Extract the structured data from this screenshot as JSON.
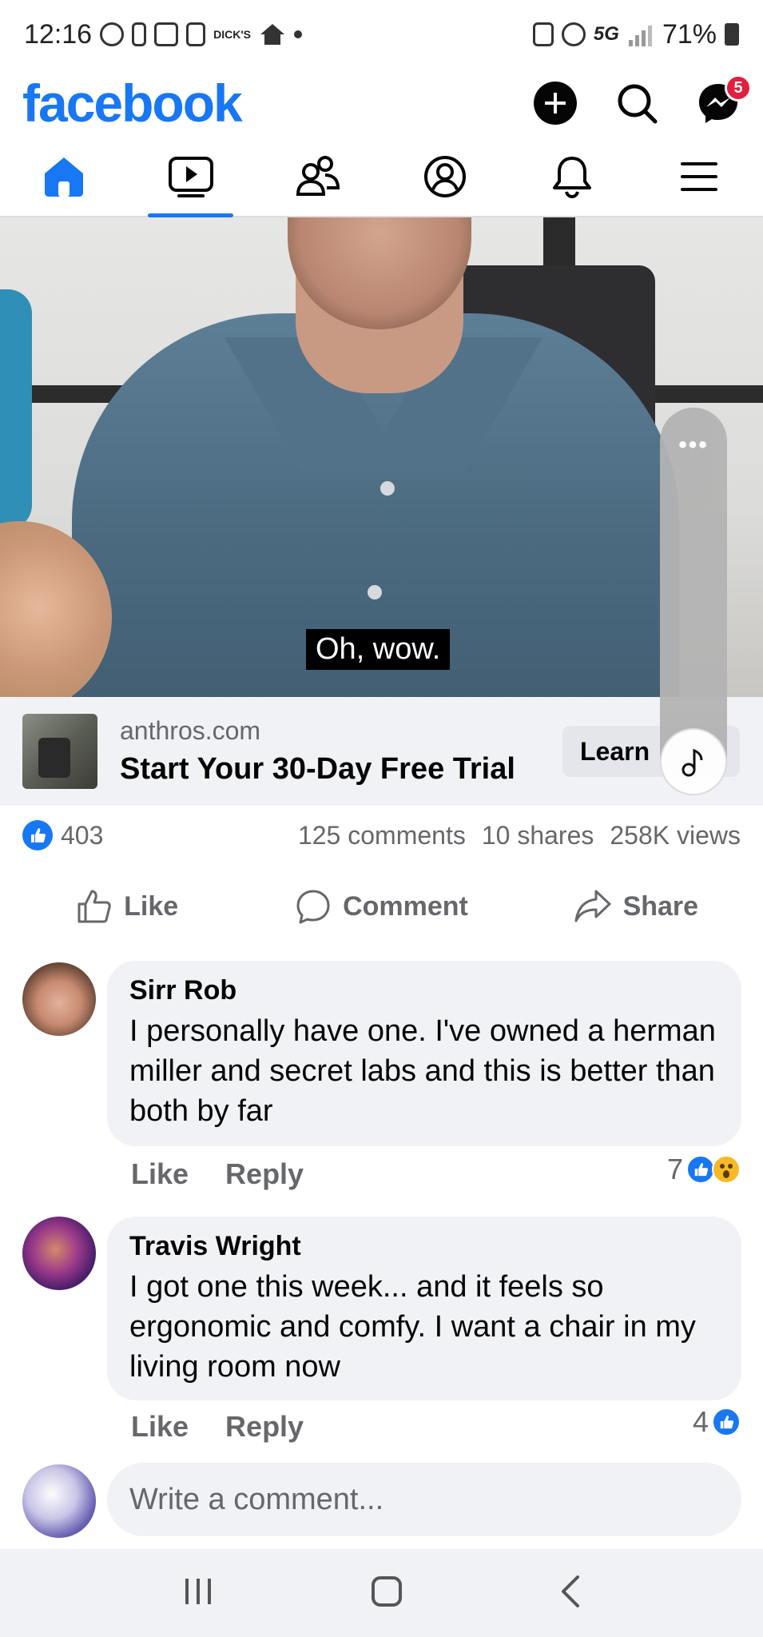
{
  "status_bar": {
    "time": "12:16",
    "dicks_label": "DICK'S",
    "network": "5G",
    "battery": "71%"
  },
  "header": {
    "logo": "facebook",
    "messenger_badge": "5"
  },
  "nav": {
    "tabs": [
      "home",
      "video",
      "friends",
      "profile",
      "notifications",
      "menu"
    ],
    "active": "video"
  },
  "video": {
    "caption": "Oh, wow.",
    "menu_dots": "•••"
  },
  "ad": {
    "domain": "anthros.com",
    "title": "Start Your 30-Day Free Trial",
    "cta": "Learn"
  },
  "stats": {
    "reactions": "403",
    "comments": "125 comments",
    "shares": "10 shares",
    "views": "258K views"
  },
  "actions": {
    "like": "Like",
    "comment": "Comment",
    "share": "Share"
  },
  "comments": [
    {
      "name": "Sirr Rob",
      "text": "I personally have one. I've owned a herman miller and secret labs and this is better than both by far",
      "like": "Like",
      "reply": "Reply",
      "reaction_count": "7"
    },
    {
      "name": "Travis Wright",
      "text": "I got one this week... and it feels so ergonomic and comfy. I want a chair in my living room now",
      "like": "Like",
      "reply": "Reply",
      "reaction_count": "4"
    }
  ],
  "write_comment": {
    "placeholder": "Write a comment..."
  },
  "colors": {
    "brand": "#1877f2",
    "badge": "#e41e3f",
    "bubble": "#f0f2f5",
    "secondary_text": "#65676b"
  }
}
